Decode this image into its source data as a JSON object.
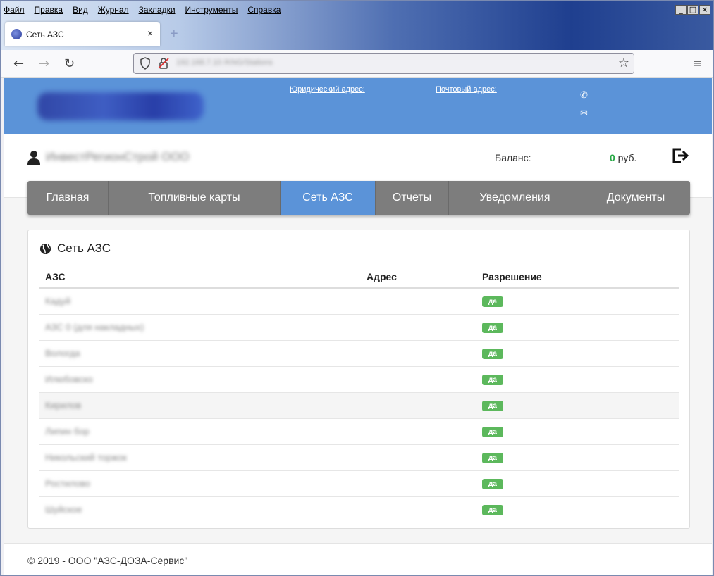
{
  "browser": {
    "menu": [
      "Файл",
      "Правка",
      "Вид",
      "Журнал",
      "Закладки",
      "Инструменты",
      "Справка"
    ],
    "window_buttons": [
      "_",
      "□",
      "×"
    ],
    "tab_title": "Сеть АЗС",
    "tab_close": "×",
    "new_tab": "+",
    "url": "192.168.7.10 /KNG/Stations",
    "icons": {
      "back": "←",
      "forward": "→",
      "reload": "↻",
      "star": "☆",
      "menu": "≡"
    }
  },
  "header": {
    "legal_address_label": "Юридический адрес:",
    "postal_address_label": "Почтовый адрес:",
    "phone_icon": "✆",
    "mail_icon": "✉"
  },
  "user": {
    "name": "ИнвестРегионСтрой ООО",
    "balance_label": "Баланс:",
    "balance_value": "0",
    "balance_currency": " руб."
  },
  "nav_tabs": [
    {
      "label": "Главная",
      "active": false
    },
    {
      "label": "Топливные карты",
      "active": false
    },
    {
      "label": "Сеть АЗС",
      "active": true
    },
    {
      "label": "Отчеты",
      "active": false
    },
    {
      "label": "Уведомления",
      "active": false
    },
    {
      "label": "Документы",
      "active": false
    }
  ],
  "stations": {
    "title": "Сеть АЗС",
    "columns": [
      "АЗС",
      "Адрес",
      "Разрешение"
    ],
    "rows": [
      {
        "name": "Кадуй",
        "address": "",
        "permission": "да"
      },
      {
        "name": "АЗС 0 (для накладных)",
        "address": "",
        "permission": "да"
      },
      {
        "name": "Вологда",
        "address": "",
        "permission": "да"
      },
      {
        "name": "Илюбовско",
        "address": "",
        "permission": "да"
      },
      {
        "name": "Кирилов",
        "address": "",
        "permission": "да"
      },
      {
        "name": "Липин бор",
        "address": "",
        "permission": "да"
      },
      {
        "name": "Никольский торжок",
        "address": "",
        "permission": "да"
      },
      {
        "name": "Ростилово",
        "address": "",
        "permission": "да"
      },
      {
        "name": "Шуйское",
        "address": "",
        "permission": "да"
      }
    ]
  },
  "footer": {
    "copyright": "© 2019 - ООО \"АЗС-ДОЗА-Сервис\""
  }
}
